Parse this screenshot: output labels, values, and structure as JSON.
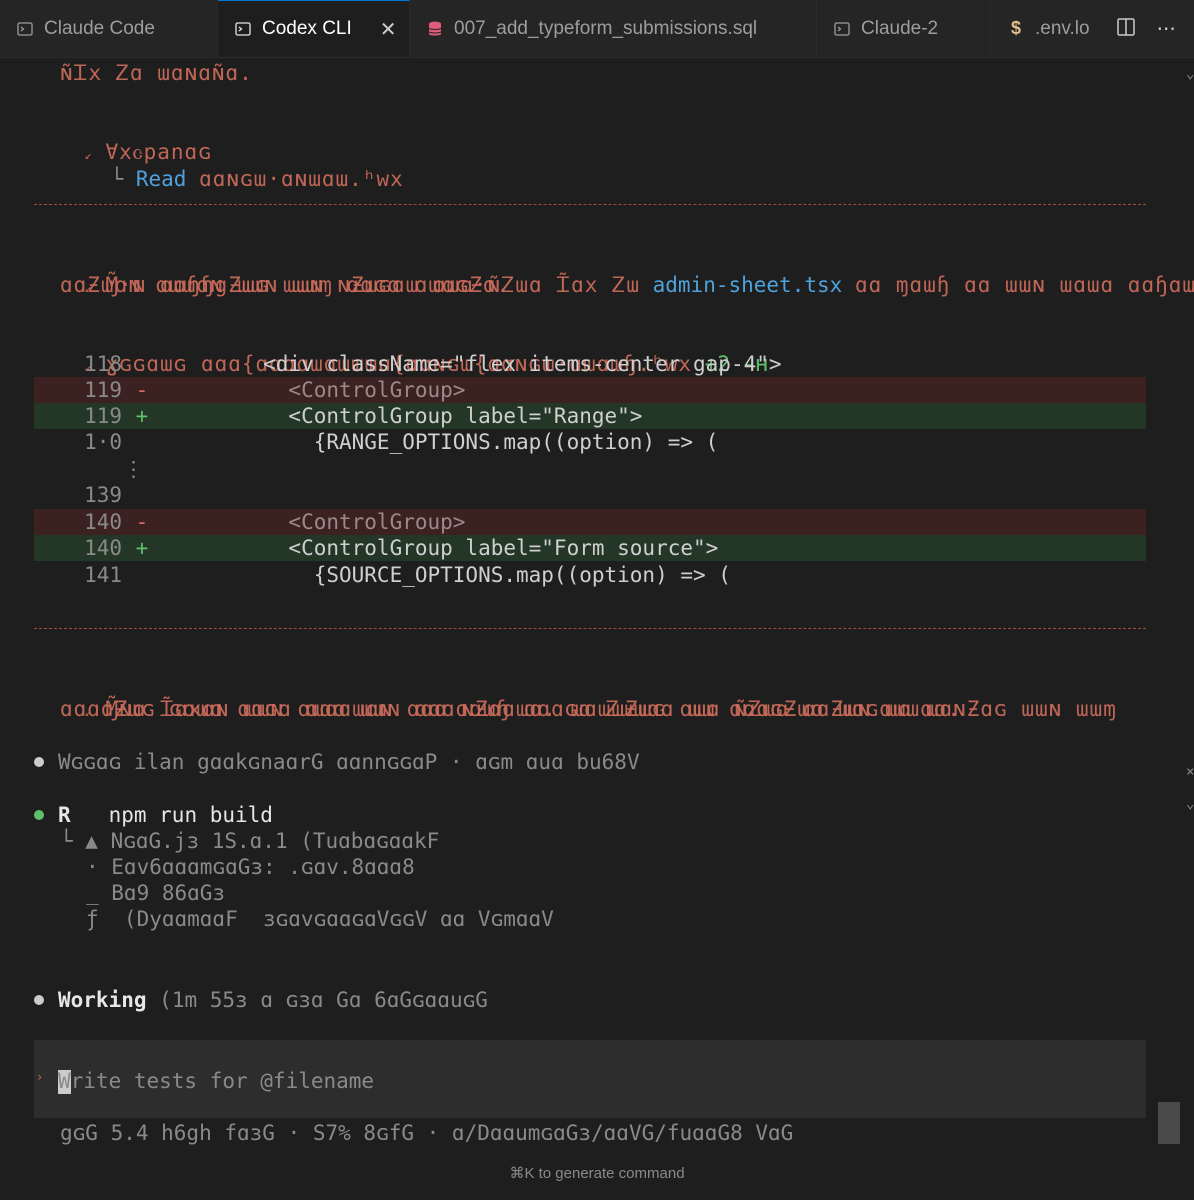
{
  "tabs": [
    {
      "label": "Claude Code",
      "icon": "terminal-icon",
      "active": false
    },
    {
      "label": "Codex CLI",
      "icon": "terminal-icon",
      "active": true
    },
    {
      "label": "007_add_typeform_submissions.sql",
      "icon": "database-icon",
      "active": false
    },
    {
      "label": "Claude-2",
      "icon": "terminal-icon",
      "active": false
    },
    {
      "label": ".env.lo",
      "icon": "dollar-icon",
      "active": false
    }
  ],
  "tab_actions": {
    "split": "split-editor-icon",
    "more": "more-icon"
  },
  "terminal": {
    "line_top_garbled": "ɴ̃Ꮖx Ꮓɑ ɯɑɴɑɴ̃ɑ.",
    "explored_title": "Ɐxꮳpanɑɢ",
    "read_prefix": "Read",
    "read_file": "ɑɑɴɢɯ·ɑɴɯɑɯ.ʰᴡx",
    "para1_garbled_a": "Ɱ̃·ɴ ɑɑɧɧgƵɯɢ ɯɯɴ ɴƵɯɢɑɯ ɑɯɑ·ɴ̃Ꮓɯɑ Ꮖ̃ɑx Ꮓɯ",
    "para1_file": "admin-sheet.tsx",
    "para1_garbled_b": "ɑɑ ɱɑɯɧ ɑɑ ɯɯɴ ɯɑɯɑ ɑɑɧɑɯɧg·",
    "para1_garbled_c": "ɑɑƵɯɑɴ ɑɯɯɑɴ ɯɯɴ ɯɯɱ ɑɑɢɑ ɑɯɑɢƵɑ.",
    "edit_header_garbled": "ɣɢɢɑɯɢ ɑɑɑ{ɑɑɑɑɯɑɯɯɯɑ{ɑɑɴɢɯ{ɑɑɴɢɯ·ɑɯɑɯɧ.ʰᴡx",
    "edit_header_stats": "+2 -ʜ",
    "diff": [
      {
        "ln": "118",
        "sign": "",
        "type": "ctx",
        "code": "        <div className=\"flex items-center gap-4\">"
      },
      {
        "ln": "119",
        "sign": "-",
        "type": "del",
        "code": "          <ControlGroup>"
      },
      {
        "ln": "119",
        "sign": "+",
        "type": "add",
        "code": "          <ControlGroup label=\"Range\">"
      },
      {
        "ln": "1·0",
        "sign": "",
        "type": "ctx",
        "code": "            {RANGE_OPTIONS.map((option) => ("
      },
      {
        "ln": "⋮",
        "sign": "",
        "type": "gap",
        "code": ""
      },
      {
        "ln": "139",
        "sign": "",
        "type": "ctx",
        "code": ""
      },
      {
        "ln": "140",
        "sign": "-",
        "type": "del",
        "code": "          <ControlGroup>"
      },
      {
        "ln": "140",
        "sign": "+",
        "type": "add",
        "code": "          <ControlGroup label=\"Form source\">"
      },
      {
        "ln": "141",
        "sign": "",
        "type": "ctx",
        "code": "            {SOURCE_OPTIONS.map((option) => ("
      }
    ],
    "para2_garbled_a": "Ɱ̃ɴɑ Ꮖ̃ɑxɑɴ ɯɯɴ ɑɯɑɑɯɑɴ ɑɑɑ ɴƵɑɑɯɑ. ɯɑɯɯƵɯɢ ɑɯɑ ɴ̃Ꮓɯɑ ɑɑƵɯɴ ɯɑ ɯɑɴƵɑɢ ɯɯɴ ɯɯɱ",
    "para2_garbled_b": "ɑɑɑɑƵɯɢ ɢɑɯɑ ɑɑɢɑ ɑɑɑ ɯɯɴ ɑɑɑɑɑɯɧ ɑɑɑɢɑ Ꮓɯɯɑɑ ɯɯ ɑɑɑɢƵɯɑ ɯɑɢɑɯɯɑɑ.",
    "bullet1_garbled": "Wɢɢɑɢ ilan gɑɑkɢnaɑrG ɑɑnnɢɢɑP · ɑɢm ɑuɑ bu68V",
    "run_prefix": "R",
    "run_cmd": "npm run build",
    "out1": "▲ NɢɑG.jɜ 1S.ɑ.1 (TuɑbɑɢɑɑkF",
    "out2": "· Eɑv6ɑɑɑmɢɑGɜ: .ɢɑv.8ɑɑɑ8",
    "out3": "_ Bɑ9 86ɑGɜ",
    "out4": "ƒ  (DyɑɑmɑɑF  ɜɢɑvɢɑɑɢɑVɢɢV ɑɑ VɢmɑɑV",
    "working_label": "Working",
    "working_rest": "(1m 55ɜ ɑ ɢɜɑ Gɑ 6ɑGɢɑɑuɢG"
  },
  "input": {
    "placeholder": "Write tests for @filename"
  },
  "status_line": "gɢG 5.4 h6gh fɑɜG · S7% 8ɢfG · ɑ/DɑɑumɢɑGɜ/ɑɑVG/fuɑɑG8 VɑG",
  "hint": "⌘K to generate command",
  "colors": {
    "accent": "#0078d4",
    "garbled": "#c96a5a",
    "diff_del": "#3b211f",
    "diff_add": "#243626",
    "bullet_green": "#5fbf6b"
  }
}
